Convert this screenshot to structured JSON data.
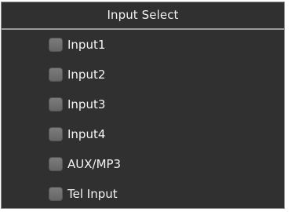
{
  "panel": {
    "title": "Input Select",
    "options": [
      {
        "label": "Input1",
        "checked": false
      },
      {
        "label": "Input2",
        "checked": false
      },
      {
        "label": "Input3",
        "checked": false
      },
      {
        "label": "Input4",
        "checked": false
      },
      {
        "label": "AUX/MP3",
        "checked": false
      },
      {
        "label": "Tel Input",
        "checked": false
      }
    ]
  },
  "colors": {
    "background": "#303030",
    "text": "#f5f5f5",
    "checkbox": "#707070",
    "divider": "#9a9a9a"
  }
}
